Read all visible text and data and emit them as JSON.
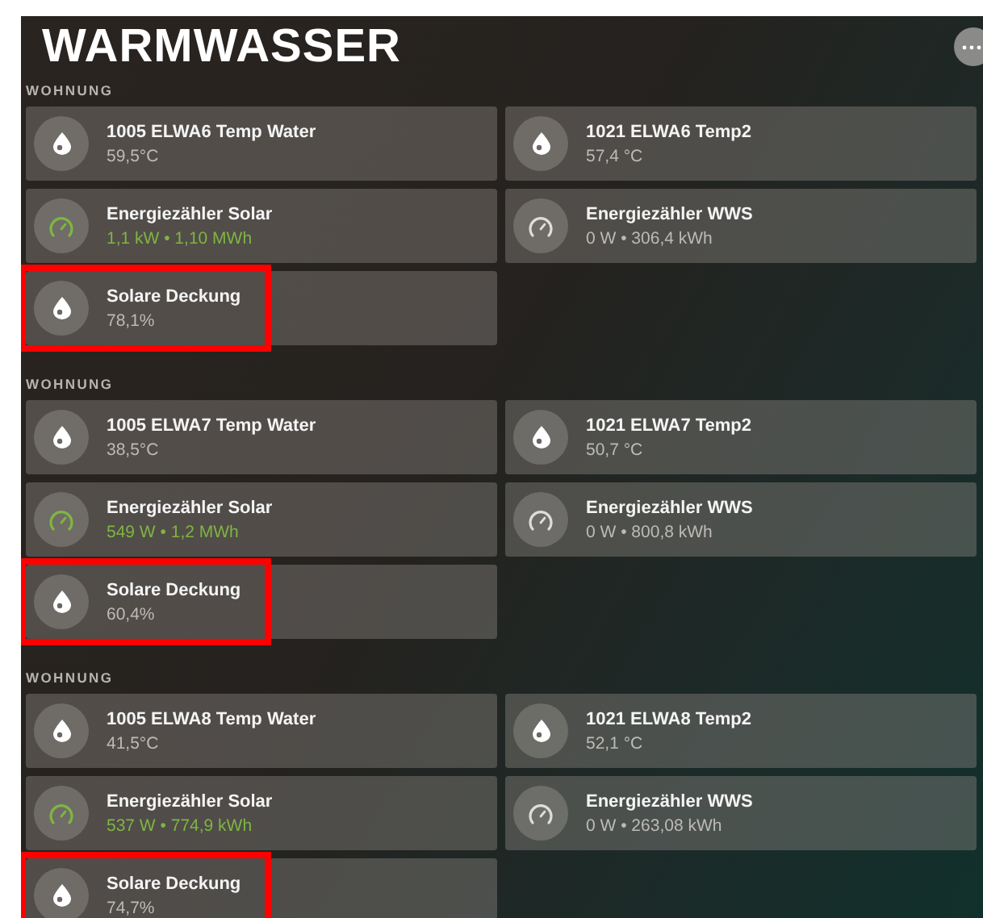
{
  "title": "WARMWASSER",
  "sections": [
    {
      "label": "WOHNUNG",
      "tiles": [
        {
          "name": "1005 ELWA6 Temp Water",
          "value": "59,5°C",
          "kind": "drop",
          "active": false,
          "highlighted": false
        },
        {
          "name": "1021 ELWA6 Temp2",
          "value": "57,4 °C",
          "kind": "drop",
          "active": false,
          "highlighted": false
        },
        {
          "name": "Energiezähler Solar",
          "value": "1,1 kW • 1,10 MWh",
          "kind": "gauge",
          "active": true,
          "highlighted": false
        },
        {
          "name": "Energiezähler WWS",
          "value": "0 W • 306,4 kWh",
          "kind": "gauge",
          "active": false,
          "highlighted": false
        },
        {
          "name": "Solare Deckung",
          "value": "78,1%",
          "kind": "drop",
          "active": false,
          "highlighted": true
        }
      ]
    },
    {
      "label": "WOHNUNG",
      "tiles": [
        {
          "name": "1005 ELWA7 Temp Water",
          "value": "38,5°C",
          "kind": "drop",
          "active": false,
          "highlighted": false
        },
        {
          "name": "1021 ELWA7 Temp2",
          "value": "50,7 °C",
          "kind": "drop",
          "active": false,
          "highlighted": false
        },
        {
          "name": "Energiezähler Solar",
          "value": "549 W • 1,2 MWh",
          "kind": "gauge",
          "active": true,
          "highlighted": false
        },
        {
          "name": "Energiezähler WWS",
          "value": "0 W • 800,8 kWh",
          "kind": "gauge",
          "active": false,
          "highlighted": false
        },
        {
          "name": "Solare Deckung",
          "value": "60,4%",
          "kind": "drop",
          "active": false,
          "highlighted": true
        }
      ]
    },
    {
      "label": "WOHNUNG",
      "tiles": [
        {
          "name": "1005 ELWA8 Temp Water",
          "value": "41,5°C",
          "kind": "drop",
          "active": false,
          "highlighted": false
        },
        {
          "name": "1021 ELWA8 Temp2",
          "value": "52,1 °C",
          "kind": "drop",
          "active": false,
          "highlighted": false
        },
        {
          "name": "Energiezähler Solar",
          "value": "537 W • 774,9 kWh",
          "kind": "gauge",
          "active": true,
          "highlighted": false
        },
        {
          "name": "Energiezähler WWS",
          "value": "0 W • 263,08 kWh",
          "kind": "gauge",
          "active": false,
          "highlighted": false
        },
        {
          "name": "Solare Deckung",
          "value": "74,7%",
          "kind": "drop",
          "active": false,
          "highlighted": true
        }
      ]
    }
  ]
}
